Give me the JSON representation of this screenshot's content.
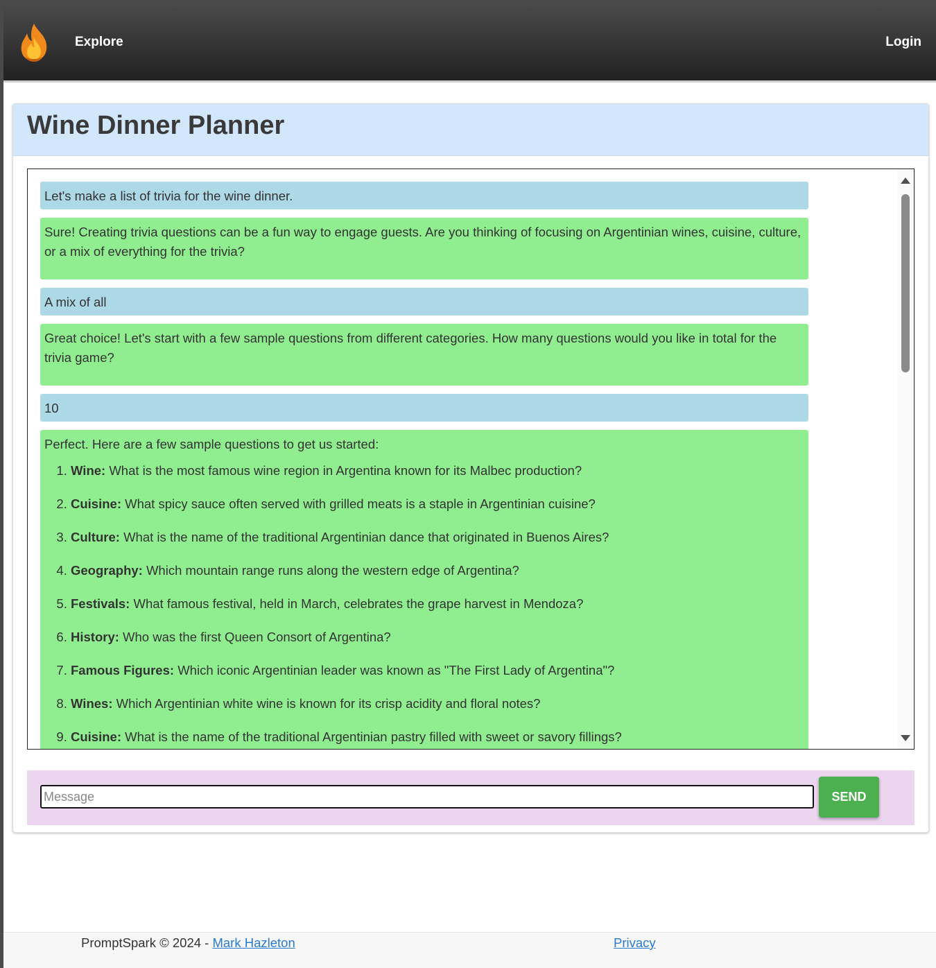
{
  "nav": {
    "logo_icon": "flame-icon",
    "explore_label": "Explore",
    "login_label": "Login"
  },
  "card": {
    "title": "Wine Dinner Planner"
  },
  "conversation": [
    {
      "role": "user",
      "text": "Let's make a list of trivia for the wine dinner."
    },
    {
      "role": "assistant",
      "text": "Sure! Creating trivia questions can be a fun way to engage guests. Are you thinking of focusing on Argentinian wines, cuisine, culture, or a mix of everything for the trivia?"
    },
    {
      "role": "user",
      "text": "A mix of all"
    },
    {
      "role": "assistant",
      "text": "Great choice! Let's start with a few sample questions from different categories. How many questions would you like in total for the trivia game?"
    },
    {
      "role": "user",
      "text": "10"
    },
    {
      "role": "assistant",
      "intro": "Perfect. Here are a few sample questions to get us started:",
      "items": [
        {
          "category": "Wine:",
          "question": "What is the most famous wine region in Argentina known for its Malbec production?"
        },
        {
          "category": "Cuisine:",
          "question": "What spicy sauce often served with grilled meats is a staple in Argentinian cuisine?"
        },
        {
          "category": "Culture:",
          "question": "What is the name of the traditional Argentinian dance that originated in Buenos Aires?"
        },
        {
          "category": "Geography:",
          "question": "Which mountain range runs along the western edge of Argentina?"
        },
        {
          "category": "Festivals:",
          "question": "What famous festival, held in March, celebrates the grape harvest in Mendoza?"
        },
        {
          "category": "History:",
          "question": "Who was the first Queen Consort of Argentina?"
        },
        {
          "category": "Famous Figures:",
          "question": "Which iconic Argentinian leader was known as \"The First Lady of Argentina\"?"
        },
        {
          "category": "Wines:",
          "question": "Which Argentinian white wine is known for its crisp acidity and floral notes?"
        },
        {
          "category": "Cuisine:",
          "question": "What is the name of the traditional Argentinian pastry filled with sweet or savory fillings?"
        }
      ]
    }
  ],
  "composer": {
    "placeholder": "Message",
    "send_label": "SEND"
  },
  "footer": {
    "copyright": "PromptSpark © 2024 - ",
    "author_link": "Mark Hazleton",
    "privacy_link": "Privacy"
  },
  "colors": {
    "user_bubble": "#add8e6",
    "assistant_bubble": "#90ee90",
    "header_bg": "#d2e7fb",
    "composer_bg": "#ecd5ef",
    "send_button": "#4caf50",
    "link": "#2a7ad1"
  }
}
